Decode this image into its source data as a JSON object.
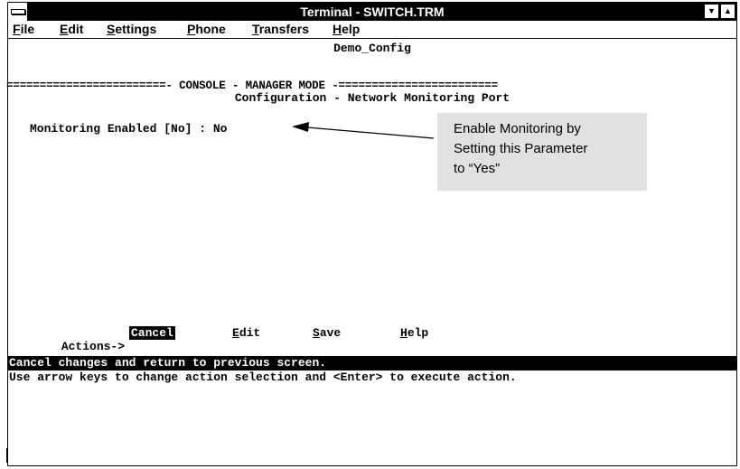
{
  "window": {
    "title": "Terminal - SWITCH.TRM"
  },
  "menu": [
    {
      "key": "F",
      "rest": "ile"
    },
    {
      "key": "E",
      "rest": "dit"
    },
    {
      "key": "S",
      "rest": "ettings"
    },
    {
      "key": "P",
      "rest": "hone"
    },
    {
      "key": "T",
      "rest": "ransfers"
    },
    {
      "key": "H",
      "rest": "elp"
    }
  ],
  "screen": {
    "hostname": "Demo_Config",
    "mode_line": "========================- CONSOLE - MANAGER MODE -========================",
    "page_title": "Configuration - Network Monitoring Port",
    "field_label": "Monitoring Enabled [No] : ",
    "field_value": "No",
    "actions_label": "Actions->",
    "actions": [
      {
        "key": "",
        "rest": "Cancel",
        "selected": true
      },
      {
        "key": "E",
        "rest": "dit",
        "selected": false
      },
      {
        "key": "S",
        "rest": "ave",
        "selected": false
      },
      {
        "key": "H",
        "rest": "elp",
        "selected": false
      }
    ],
    "status_line": "Cancel changes and return to previous screen.",
    "help_line": "Use arrow keys to change action selection and <Enter> to execute action."
  },
  "callout": {
    "lines": [
      "Enable Monitoring by",
      "Setting this Parameter",
      "to “Yes”"
    ],
    "background": "#e1e1e1"
  }
}
